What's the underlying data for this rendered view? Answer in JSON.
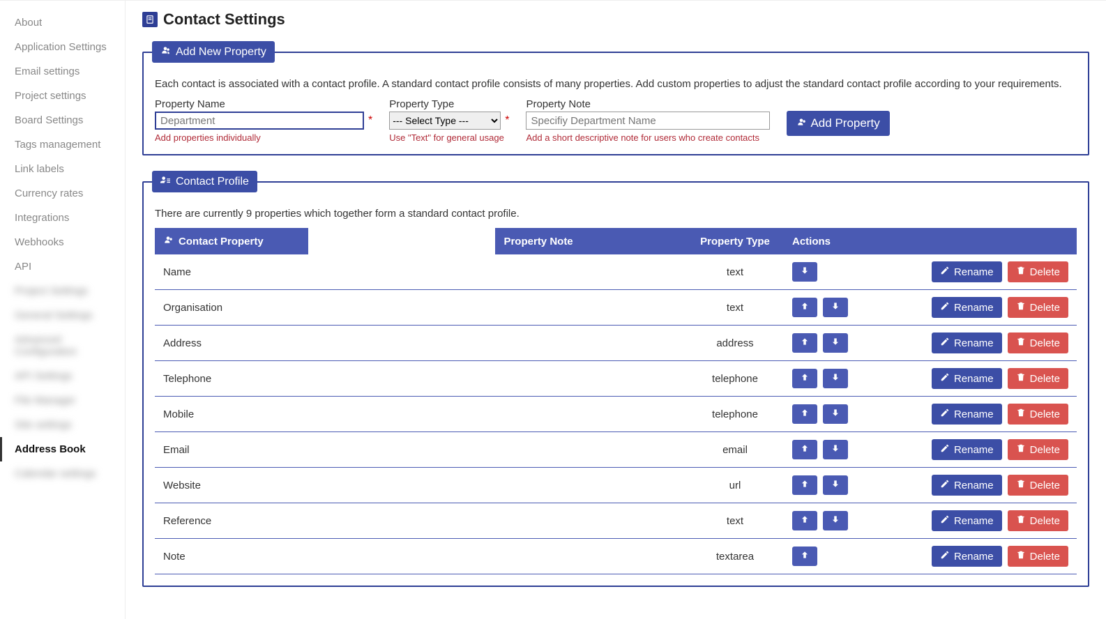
{
  "page": {
    "title": "Contact Settings"
  },
  "sidebar": {
    "items": [
      {
        "label": "About",
        "active": false,
        "blurred": false
      },
      {
        "label": "Application Settings",
        "active": false,
        "blurred": false
      },
      {
        "label": "Email settings",
        "active": false,
        "blurred": false
      },
      {
        "label": "Project settings",
        "active": false,
        "blurred": false
      },
      {
        "label": "Board Settings",
        "active": false,
        "blurred": false
      },
      {
        "label": "Tags management",
        "active": false,
        "blurred": false
      },
      {
        "label": "Link labels",
        "active": false,
        "blurred": false
      },
      {
        "label": "Currency rates",
        "active": false,
        "blurred": false
      },
      {
        "label": "Integrations",
        "active": false,
        "blurred": false
      },
      {
        "label": "Webhooks",
        "active": false,
        "blurred": false
      },
      {
        "label": "API",
        "active": false,
        "blurred": false
      },
      {
        "label": "Project Settings",
        "active": false,
        "blurred": true
      },
      {
        "label": "General Settings",
        "active": false,
        "blurred": true
      },
      {
        "label": "Advanced Configuration",
        "active": false,
        "blurred": true
      },
      {
        "label": "API Settings",
        "active": false,
        "blurred": true
      },
      {
        "label": "File Manager",
        "active": false,
        "blurred": true
      },
      {
        "label": "Site settings",
        "active": false,
        "blurred": true
      },
      {
        "label": "Address Book",
        "active": true,
        "blurred": false
      },
      {
        "label": "Calendar settings",
        "active": false,
        "blurred": true
      }
    ]
  },
  "add_panel": {
    "legend": "Add New Property",
    "description": "Each contact is associated with a contact profile. A standard contact profile consists of many properties. Add custom properties to adjust the standard contact profile according to your requirements.",
    "name_label": "Property Name",
    "name_placeholder": "Department",
    "name_hint": "Add properties individually",
    "type_label": "Property Type",
    "type_placeholder": "--- Select Type ---",
    "type_hint": "Use \"Text\" for general usage",
    "note_label": "Property Note",
    "note_placeholder": "Specifiy Department Name",
    "note_hint": "Add a short descriptive note for users who create contacts",
    "button_label": "Add Property"
  },
  "profile_panel": {
    "legend": "Contact Profile",
    "description": "There are currently 9 properties which together form a standard contact profile.",
    "headers": {
      "property": "Contact Property",
      "note": "Property Note",
      "type": "Property Type",
      "actions": "Actions"
    },
    "rename_label": "Rename",
    "delete_label": "Delete",
    "rows": [
      {
        "name": "Name",
        "note": "",
        "type": "text",
        "up": false,
        "down": true
      },
      {
        "name": "Organisation",
        "note": "",
        "type": "text",
        "up": true,
        "down": true
      },
      {
        "name": "Address",
        "note": "",
        "type": "address",
        "up": true,
        "down": true
      },
      {
        "name": "Telephone",
        "note": "",
        "type": "telephone",
        "up": true,
        "down": true
      },
      {
        "name": "Mobile",
        "note": "",
        "type": "telephone",
        "up": true,
        "down": true
      },
      {
        "name": "Email",
        "note": "",
        "type": "email",
        "up": true,
        "down": true
      },
      {
        "name": "Website",
        "note": "",
        "type": "url",
        "up": true,
        "down": true
      },
      {
        "name": "Reference",
        "note": "",
        "type": "text",
        "up": true,
        "down": true
      },
      {
        "name": "Note",
        "note": "",
        "type": "textarea",
        "up": true,
        "down": false
      }
    ]
  }
}
